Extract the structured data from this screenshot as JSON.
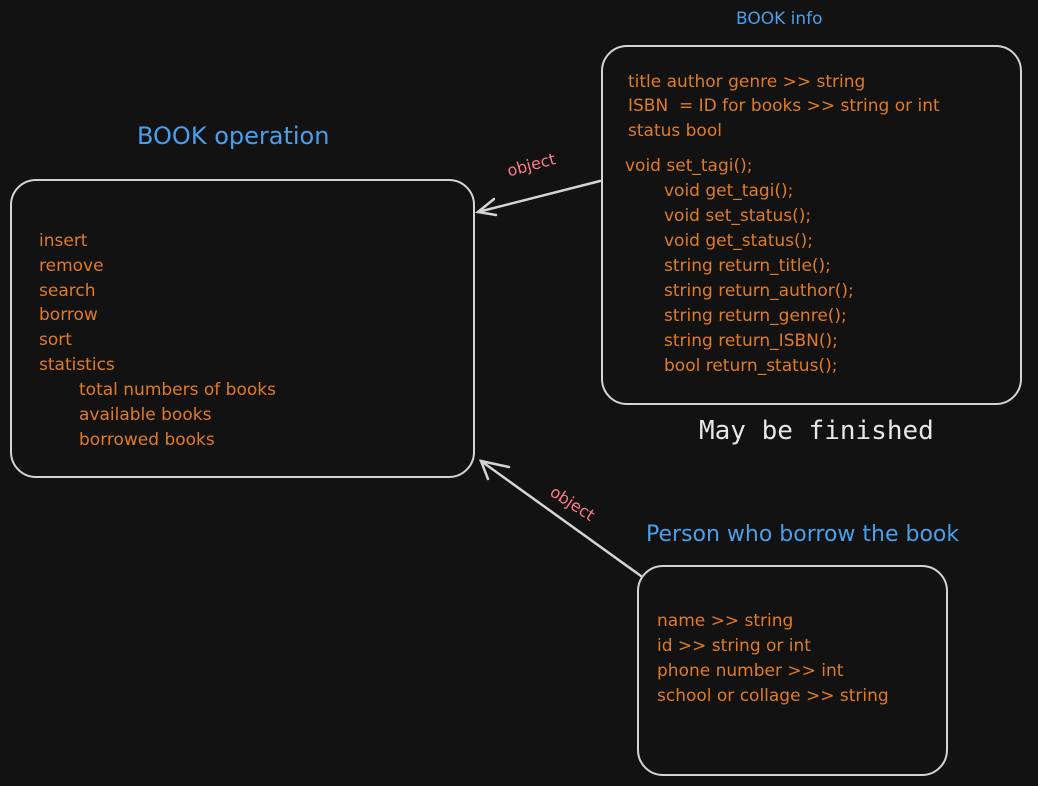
{
  "book_operation": {
    "title": "BOOK operation",
    "lines": [
      "insert",
      "remove",
      "search",
      "borrow",
      "sort",
      "statistics"
    ],
    "sub_lines": [
      "total numbers of books",
      "available books",
      "borrowed books"
    ]
  },
  "book_info": {
    "title": "BOOK info",
    "fields": [
      "title author genre >> string",
      "ISBN  = ID for books >> string or int",
      "status bool"
    ],
    "methods": [
      "void set_tagi();",
      "void get_tagi();",
      "void set_status();",
      "void get_status();",
      "string return_title();",
      "string return_author();",
      "string return_genre();",
      "string return_ISBN();",
      "bool return_status();"
    ],
    "note": "May be finished"
  },
  "person": {
    "title": "Person who borrow the book",
    "fields": [
      "name >> string",
      "id >> string or int",
      "phone number >> int",
      "school or collage >> string"
    ]
  },
  "arrows": {
    "info_to_operation_label": "object",
    "person_to_operation_label": "object"
  },
  "colors": {
    "background": "#121212",
    "title": "#4a9fea",
    "text": "#e07b26",
    "arrow_label": "#ff7a8a",
    "stroke": "#d4d4d4"
  }
}
